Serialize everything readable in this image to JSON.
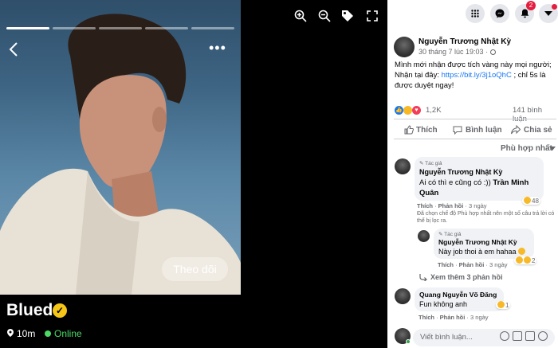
{
  "profile": {
    "follow_label": "Theo dõi",
    "name": "Blued",
    "distance": "10m",
    "status": "Online"
  },
  "facebook": {
    "notification_count": "2",
    "post": {
      "author": "Nguyễn Trương Nhật Kỳ",
      "time": "30 tháng 7 lúc 19:03 ·",
      "text_before": "Mình mới nhận được tích vàng này mọi người; Nhận tại đây: ",
      "link": "https://bit.ly/3j1oQhC",
      "text_after": " ; chỉ 5s là được duyệt ngay!",
      "reaction_count": "1,2K",
      "comment_count": "141 bình luận"
    },
    "actions": {
      "like": "Thích",
      "comment": "Bình luận",
      "share": "Chia sẻ"
    },
    "sort_label": "Phù hợp nhất",
    "comments": [
      {
        "tag": "Tác giả",
        "name": "Nguyễn Trương Nhật Kỳ",
        "text": "Ai có thì e cũng có :))",
        "mention": "Trần Minh Quân",
        "reactions": "48",
        "like": "Thích",
        "reply": "Phản hồi",
        "time": "3 ngày",
        "note": "Đã chọn chế độ Phù hợp nhất nên một số câu trả lời có thể bị lọc ra."
      },
      {
        "tag": "Tác giả",
        "name": "Nguyễn Trương Nhật Kỳ",
        "text": "Này job thoi à em hahaa",
        "reactions": "2",
        "like": "Thích",
        "reply": "Phản hồi",
        "time": "3 ngày"
      },
      {
        "name": "Quang Nguyễn Võ Đăng",
        "text": "Fun không anh",
        "reactions": "1",
        "like": "Thích",
        "reply": "Phản hồi",
        "time": "3 ngày"
      }
    ],
    "more_replies": "Xem thêm 3 phản hồi",
    "input_placeholder": "Viết bình luận..."
  },
  "colors": {
    "facebook_blue": "#1877f2",
    "online_green": "#4cd964",
    "verified_gold": "#f5c518",
    "notification_red": "#e41e3f"
  }
}
